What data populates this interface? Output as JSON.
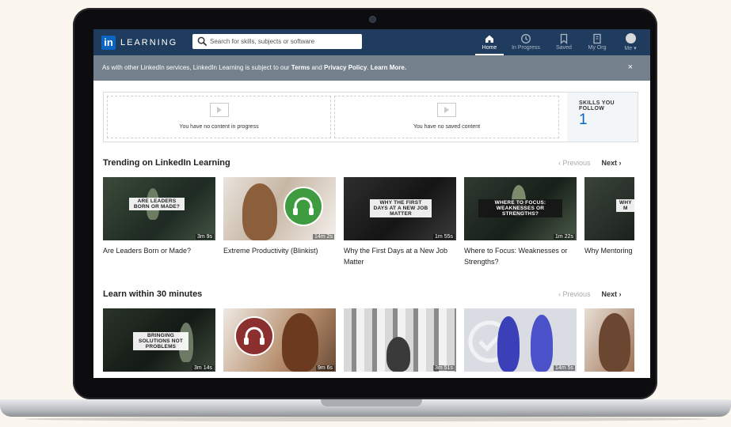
{
  "brand": {
    "logo": "in",
    "name": "LEARNING"
  },
  "search": {
    "placeholder": "Search for skills, subjects or software"
  },
  "nav": [
    {
      "label": "Home",
      "icon": "home-icon"
    },
    {
      "label": "In Progress",
      "icon": "clock-icon"
    },
    {
      "label": "Saved",
      "icon": "bookmark-icon"
    },
    {
      "label": "My Org",
      "icon": "building-icon"
    },
    {
      "label": "Me ▾",
      "icon": "avatar"
    }
  ],
  "notice": {
    "prefix": "As with other LinkedIn services, LinkedIn Learning is subject to our ",
    "terms": "Terms",
    "and": " and ",
    "privacy": "Privacy Policy",
    "period": ". ",
    "learn_more": "Learn More.",
    "close": "×"
  },
  "panels": {
    "in_progress_empty": "You have no content in progress",
    "saved_empty": "You have no saved content",
    "skills_title": "SKILLS YOU FOLLOW",
    "skills_count": "1"
  },
  "pager": {
    "previous": "‹ Previous",
    "next": "Next ›"
  },
  "sections": [
    {
      "title": "Trending on LinkedIn Learning",
      "courses": [
        {
          "title": "Are Leaders Born or Made?",
          "duration": "3m 9s",
          "caption": "ARE LEADERS BORN OR MADE?"
        },
        {
          "title": "Extreme Productivity (Blinkist)",
          "duration": "14m 2s",
          "caption": ""
        },
        {
          "title": "Why the First Days at a New Job Matter",
          "duration": "1m 55s",
          "caption": "WHY THE FIRST DAYS AT A NEW JOB MATTER"
        },
        {
          "title": "Where to Focus: Weaknesses or Strengths?",
          "duration": "1m 22s",
          "caption": "WHERE TO FOCUS: WEAKNESSES OR STRENGTHS?"
        },
        {
          "title": "Why Mentoring",
          "duration": "",
          "caption": "WHY M"
        }
      ]
    },
    {
      "title": "Learn within 30 minutes",
      "courses": [
        {
          "title": "",
          "duration": "3m 14s",
          "caption": "BRINGING SOLUTIONS NOT PROBLEMS"
        },
        {
          "title": "",
          "duration": "9m 6s",
          "caption": ""
        },
        {
          "title": "",
          "duration": "3m 51s",
          "caption": ""
        },
        {
          "title": "",
          "duration": "14m 5s",
          "caption": ""
        },
        {
          "title": "",
          "duration": "",
          "caption": ""
        }
      ]
    }
  ],
  "colors": {
    "header": "#1f3c5f",
    "notice": "#74808c",
    "accent": "#0a66c2"
  }
}
